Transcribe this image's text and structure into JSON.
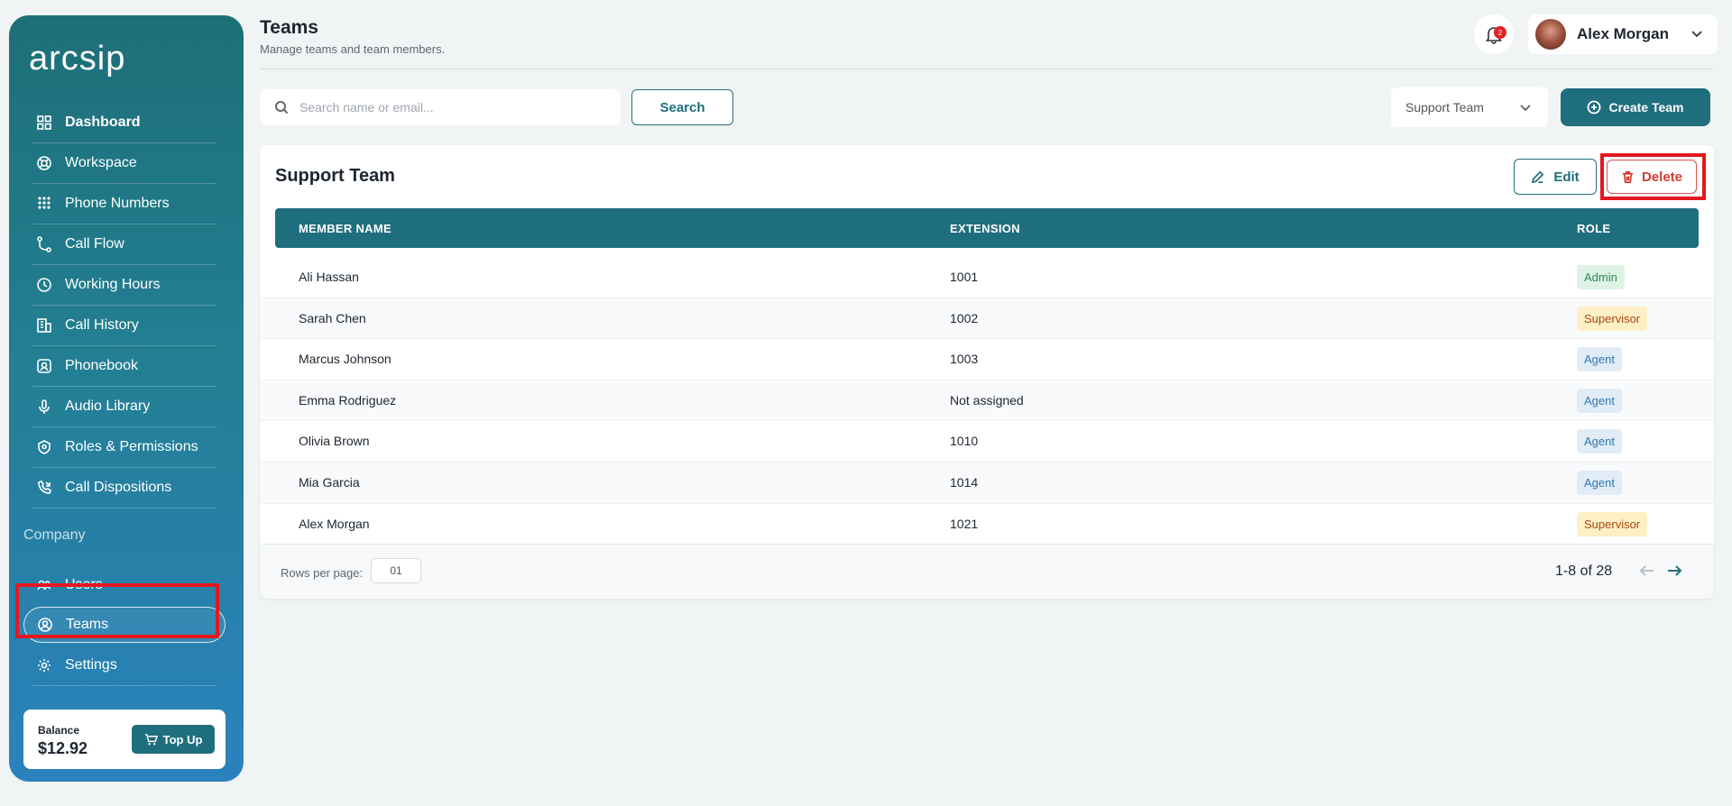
{
  "sidebar": {
    "logo": "arcsip",
    "items": [
      {
        "label": "Dashboard"
      },
      {
        "label": "Workspace"
      },
      {
        "label": "Phone Numbers"
      },
      {
        "label": "Call Flow"
      },
      {
        "label": "Working Hours"
      },
      {
        "label": "Call History"
      },
      {
        "label": "Phonebook"
      },
      {
        "label": "Audio Library"
      },
      {
        "label": "Roles & Permissions"
      },
      {
        "label": "Call Dispositions"
      }
    ],
    "section_title": "Company",
    "company_items": [
      {
        "label": "Users"
      },
      {
        "label": "Teams"
      },
      {
        "label": "Settings"
      }
    ],
    "balance": {
      "label": "Balance",
      "value": "$12.92",
      "button": "Top Up"
    }
  },
  "header": {
    "title": "Teams",
    "subtitle": "Manage teams and team members.",
    "notification_count": "2",
    "user_name": "Alex Morgan"
  },
  "toolbar": {
    "search_placeholder": "Search name or email...",
    "search_button": "Search",
    "team_select": "Support Team",
    "create_button": "Create Team"
  },
  "card": {
    "title": "Support Team",
    "edit_button": "Edit",
    "delete_button": "Delete",
    "columns": {
      "name": "MEMBER NAME",
      "extension": "EXTENSION",
      "role": "ROLE"
    },
    "rows": [
      {
        "name": "Ali Hassan",
        "extension": "1001",
        "role": "Admin"
      },
      {
        "name": "Sarah Chen",
        "extension": "1002",
        "role": "Supervisor"
      },
      {
        "name": "Marcus Johnson",
        "extension": "1003",
        "role": "Agent"
      },
      {
        "name": "Emma Rodriguez",
        "extension": "Not assigned",
        "role": "Agent"
      },
      {
        "name": "Olivia Brown",
        "extension": "1010",
        "role": "Agent"
      },
      {
        "name": "Mia Garcia",
        "extension": "1014",
        "role": "Agent"
      },
      {
        "name": "Alex Morgan",
        "extension": "1021",
        "role": "Supervisor"
      }
    ],
    "footer": {
      "rows_per_page_label": "Rows per page:",
      "rows_per_page_value": "01",
      "page_info": "1-8 of 28"
    }
  },
  "colors": {
    "accent": "#1f6e7d",
    "highlight": "#e3181e",
    "danger": "#d13b32"
  }
}
